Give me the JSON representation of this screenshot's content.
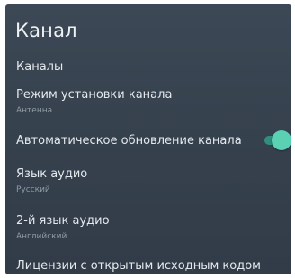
{
  "screen": {
    "title": "Канал"
  },
  "items": [
    {
      "label": "Каналы"
    },
    {
      "label": "Режим установки канала",
      "value": "Антенна"
    },
    {
      "label": "Автоматическое обновление канала",
      "toggle": true
    },
    {
      "label": "Язык аудио",
      "value": "Русский"
    },
    {
      "label": "2-й язык аудио",
      "value": "Английский"
    },
    {
      "label": "Лицензии с открытым исходным кодом"
    }
  ],
  "colors": {
    "background": "#37424f",
    "toggle_on": "#5ad1b3",
    "text_primary": "#e4e9ee",
    "text_secondary": "#8e9aa6"
  }
}
